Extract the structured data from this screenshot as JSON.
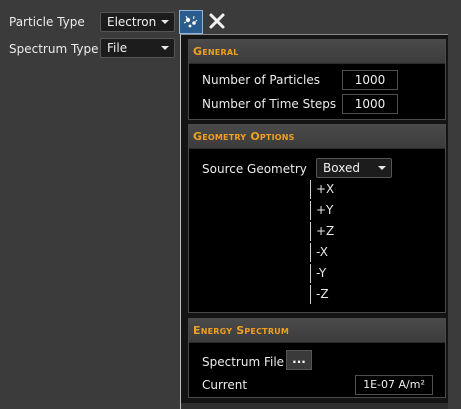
{
  "main": {
    "particle_type_label": "Particle Type",
    "particle_type_value": "Electron",
    "spectrum_type_label": "Spectrum Type",
    "spectrum_type_value": "File"
  },
  "toolbar": {
    "settings_icon": "particle-settings-icon",
    "close_icon": "close-icon"
  },
  "popup": {
    "general": {
      "title": "General",
      "num_particles_label": "Number of Particles",
      "num_particles_value": "1000",
      "num_steps_label": "Number of Time Steps",
      "num_steps_value": "1000"
    },
    "geometry": {
      "title": "Geometry Options",
      "source_geometry_label": "Source Geometry",
      "source_geometry_value": "Boxed",
      "options": [
        "+X",
        "+Y",
        "+Z",
        "-X",
        "-Y",
        "-Z"
      ]
    },
    "energy": {
      "title": "Energy Spectrum",
      "spectrum_file_label": "Spectrum File",
      "browse_label": "...",
      "current_label": "Current",
      "current_value": "1E-07 A/m²"
    }
  },
  "colors": {
    "background": "#3b3b3b",
    "section_title": "#f0a020",
    "icon_button": "#2a5d8e",
    "close_icon": "#f0f0f0"
  }
}
